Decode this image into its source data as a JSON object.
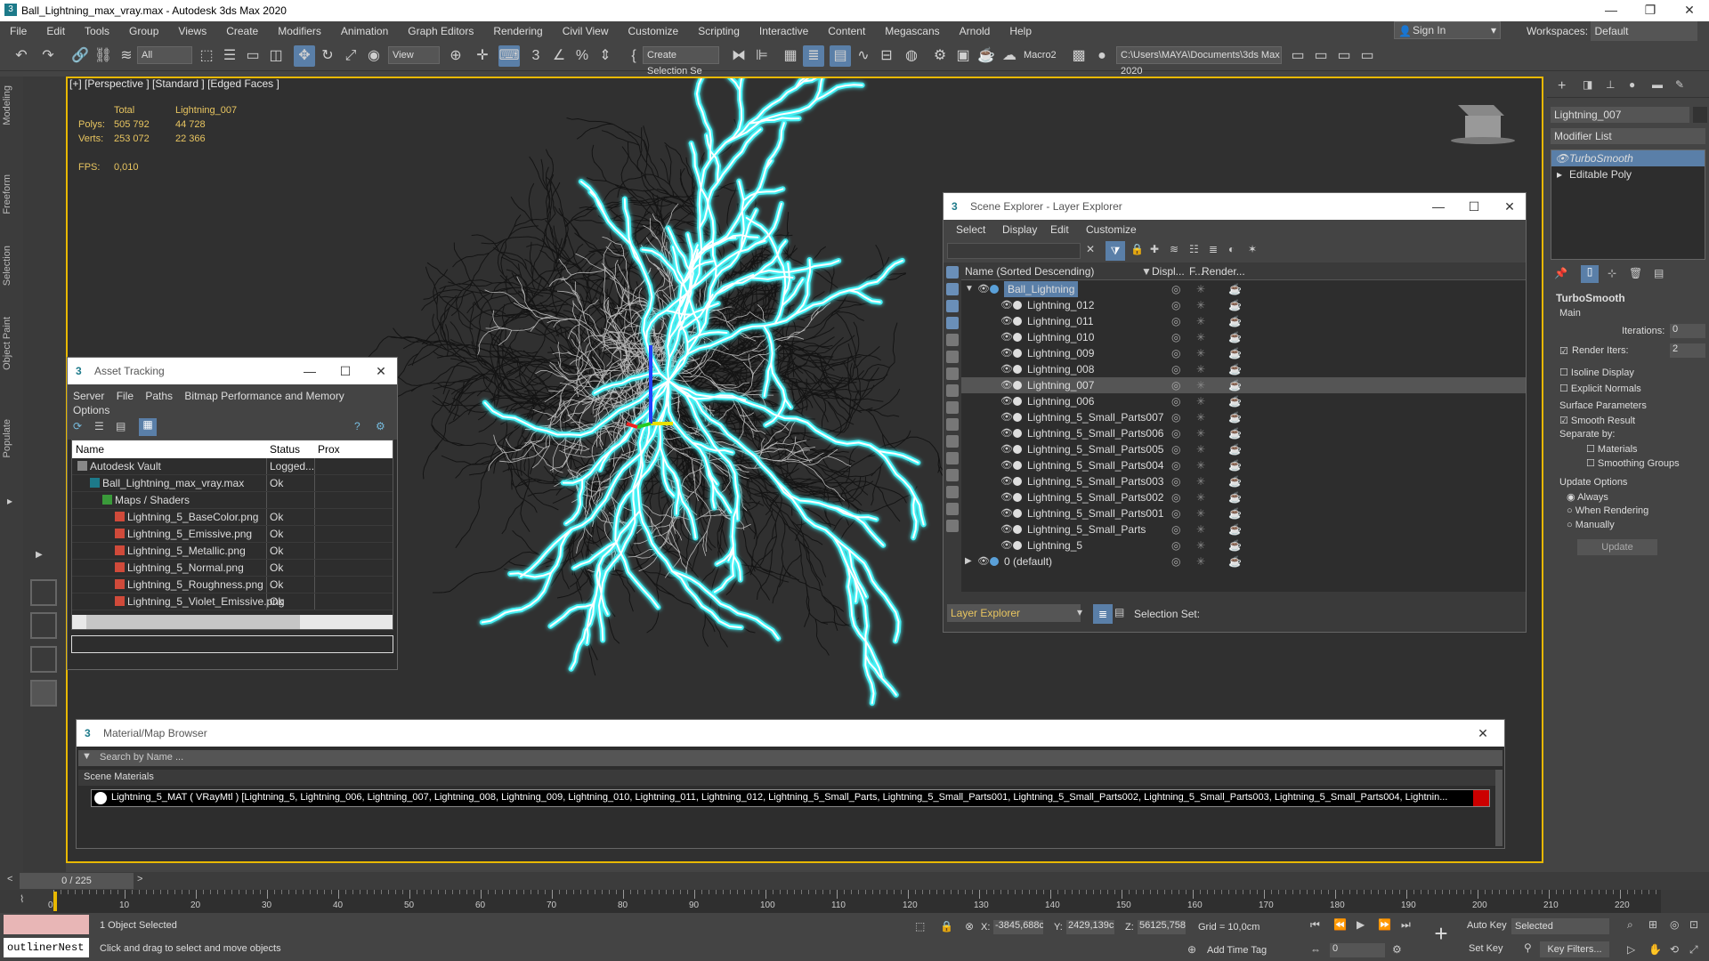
{
  "window": {
    "title": "Ball_Lightning_max_vray.max - Autodesk 3ds Max 2020",
    "minimize": "—",
    "maximize": "❐",
    "close": "✕"
  },
  "menu": [
    "File",
    "Edit",
    "Tools",
    "Group",
    "Views",
    "Create",
    "Modifiers",
    "Animation",
    "Graph Editors",
    "Rendering",
    "Civil View",
    "Customize",
    "Scripting",
    "Interactive",
    "Content",
    "Megascans",
    "Arnold",
    "Help"
  ],
  "signin": "Sign In",
  "workspaces": {
    "label": "Workspaces:",
    "value": "Default"
  },
  "toolbar": {
    "filter": "All",
    "refcoord": "View",
    "selection_set": "Create Selection Se",
    "macro": "Macro2",
    "path": "C:\\Users\\MAYA\\Documents\\3ds Max 2020"
  },
  "left_tabs": [
    "Modeling",
    "Freeform",
    "Selection",
    "Object Paint",
    "Populate"
  ],
  "viewport": {
    "label": "[+] [Perspective ] [Standard ] [Edged Faces ]",
    "stats": {
      "col1": "Total",
      "col2": "Lightning_007",
      "polys_label": "Polys:",
      "polys_total": "505 792",
      "polys_obj": "44 728",
      "verts_label": "Verts:",
      "verts_total": "253 072",
      "verts_obj": "22 366",
      "fps_label": "FPS:",
      "fps": "0,010"
    }
  },
  "asset_tracking": {
    "title": "Asset Tracking",
    "menu": [
      "Server",
      "File",
      "Paths",
      "Bitmap Performance and Memory",
      "Options"
    ],
    "columns": [
      "Name",
      "Status",
      "Prox"
    ],
    "rows": [
      {
        "name": "Autodesk Vault",
        "status": "Logged..."
      },
      {
        "name": "Ball_Lightning_max_vray.max",
        "status": "Ok"
      },
      {
        "name": "Maps / Shaders",
        "status": ""
      },
      {
        "name": "Lightning_5_BaseColor.png",
        "status": "Ok"
      },
      {
        "name": "Lightning_5_Emissive.png",
        "status": "Ok"
      },
      {
        "name": "Lightning_5_Metallic.png",
        "status": "Ok"
      },
      {
        "name": "Lightning_5_Normal.png",
        "status": "Ok"
      },
      {
        "name": "Lightning_5_Roughness.png",
        "status": "Ok"
      },
      {
        "name": "Lightning_5_Violet_Emissive.png",
        "status": "Ok"
      }
    ]
  },
  "scene_explorer": {
    "title": "Scene Explorer - Layer Explorer",
    "menu": [
      "Select",
      "Display",
      "Edit",
      "Customize"
    ],
    "columns": [
      "Name (Sorted Descending)",
      "Displ...",
      "F...",
      "Render..."
    ],
    "rows": [
      "Ball_Lightning",
      "Lightning_012",
      "Lightning_011",
      "Lightning_010",
      "Lightning_009",
      "Lightning_008",
      "Lightning_007",
      "Lightning_006",
      "Lightning_5_Small_Parts007",
      "Lightning_5_Small_Parts006",
      "Lightning_5_Small_Parts005",
      "Lightning_5_Small_Parts004",
      "Lightning_5_Small_Parts003",
      "Lightning_5_Small_Parts002",
      "Lightning_5_Small_Parts001",
      "Lightning_5_Small_Parts",
      "Lightning_5",
      "0 (default)"
    ],
    "footer": {
      "explorer": "Layer Explorer",
      "selection_set": "Selection Set:"
    }
  },
  "material_browser": {
    "title": "Material/Map Browser",
    "search": "Search by Name ...",
    "section": "Scene Materials",
    "material": "Lightning_5_MAT ( VRayMtl ) [Lightning_5, Lightning_006, Lightning_007, Lightning_008, Lightning_009, Lightning_010, Lightning_011, Lightning_012, Lightning_5_Small_Parts, Lightning_5_Small_Parts001, Lightning_5_Small_Parts002, Lightning_5_Small_Parts003, Lightning_5_Small_Parts004, Lightnin..."
  },
  "command_panel": {
    "object_name": "Lightning_007",
    "modifier_list": "Modifier List",
    "stack": [
      "TurboSmooth",
      "Editable Poly"
    ],
    "rollout": "TurboSmooth",
    "main": "Main",
    "iterations_label": "Iterations:",
    "iterations": "0",
    "render_iters_label": "Render Iters:",
    "render_iters": "2",
    "isoline": "Isoline Display",
    "explicit": "Explicit Normals",
    "surface": "Surface Parameters",
    "smooth_result": "Smooth Result",
    "separate_by": "Separate by:",
    "materials": "Materials",
    "smoothing_groups": "Smoothing Groups",
    "update_options": "Update Options",
    "always": "Always",
    "when_rendering": "When Rendering",
    "manually": "Manually",
    "update": "Update"
  },
  "timeline": {
    "frame": "0 / 225",
    "ticks": [
      "0",
      "10",
      "20",
      "30",
      "40",
      "50",
      "60",
      "70",
      "80",
      "90",
      "100",
      "110",
      "120",
      "130",
      "140",
      "150",
      "160",
      "170",
      "180",
      "190",
      "200",
      "210",
      "220"
    ]
  },
  "status": {
    "script": "outlinerNest",
    "selected": "1 Object Selected",
    "hint": "Click and drag to select and move objects",
    "x_label": "X:",
    "x": "-3845,688c",
    "y_label": "Y:",
    "y": "2429,139c",
    "z_label": "Z:",
    "z": "56125,758",
    "grid": "Grid = 10,0cm",
    "add_time_tag": "Add Time Tag",
    "auto_key": "Auto Key",
    "selected_dd": "Selected",
    "set_key": "Set Key",
    "key_filters": "Key Filters...",
    "frame_spinner": "0"
  }
}
